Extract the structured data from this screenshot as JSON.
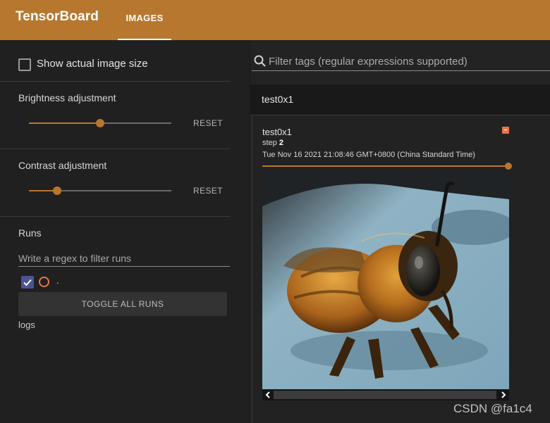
{
  "header": {
    "brand": "TensorBoard",
    "tab_label": "IMAGES"
  },
  "sidebar": {
    "show_actual_size": {
      "label": "Show actual image size",
      "checked": false
    },
    "brightness": {
      "title": "Brightness adjustment",
      "value": 0.5,
      "reset_label": "RESET"
    },
    "contrast": {
      "title": "Contrast adjustment",
      "value": 0.2,
      "reset_label": "RESET"
    },
    "runs": {
      "title": "Runs",
      "filter_placeholder": "Write a regex to filter runs",
      "items": [
        {
          "name": ".",
          "checked": true,
          "color": "#e8764a"
        }
      ],
      "toggle_label": "TOGGLE ALL RUNS",
      "logdir": "logs"
    }
  },
  "main": {
    "filter_placeholder": "Filter tags (regular expressions supported)",
    "group_title": "test0x1",
    "card": {
      "tag": "test0x1",
      "step_label": "step",
      "step_value": "2",
      "timestamp": "Tue Nov 16 2021 21:08:46 GMT+0800 (China Standard Time)",
      "step_slider_value": 1.0
    }
  },
  "watermark": "CSDN @fa1c4",
  "colors": {
    "accent": "#b8772e",
    "run_color": "#e8764a",
    "checkbox_checked": "#4c5491"
  }
}
